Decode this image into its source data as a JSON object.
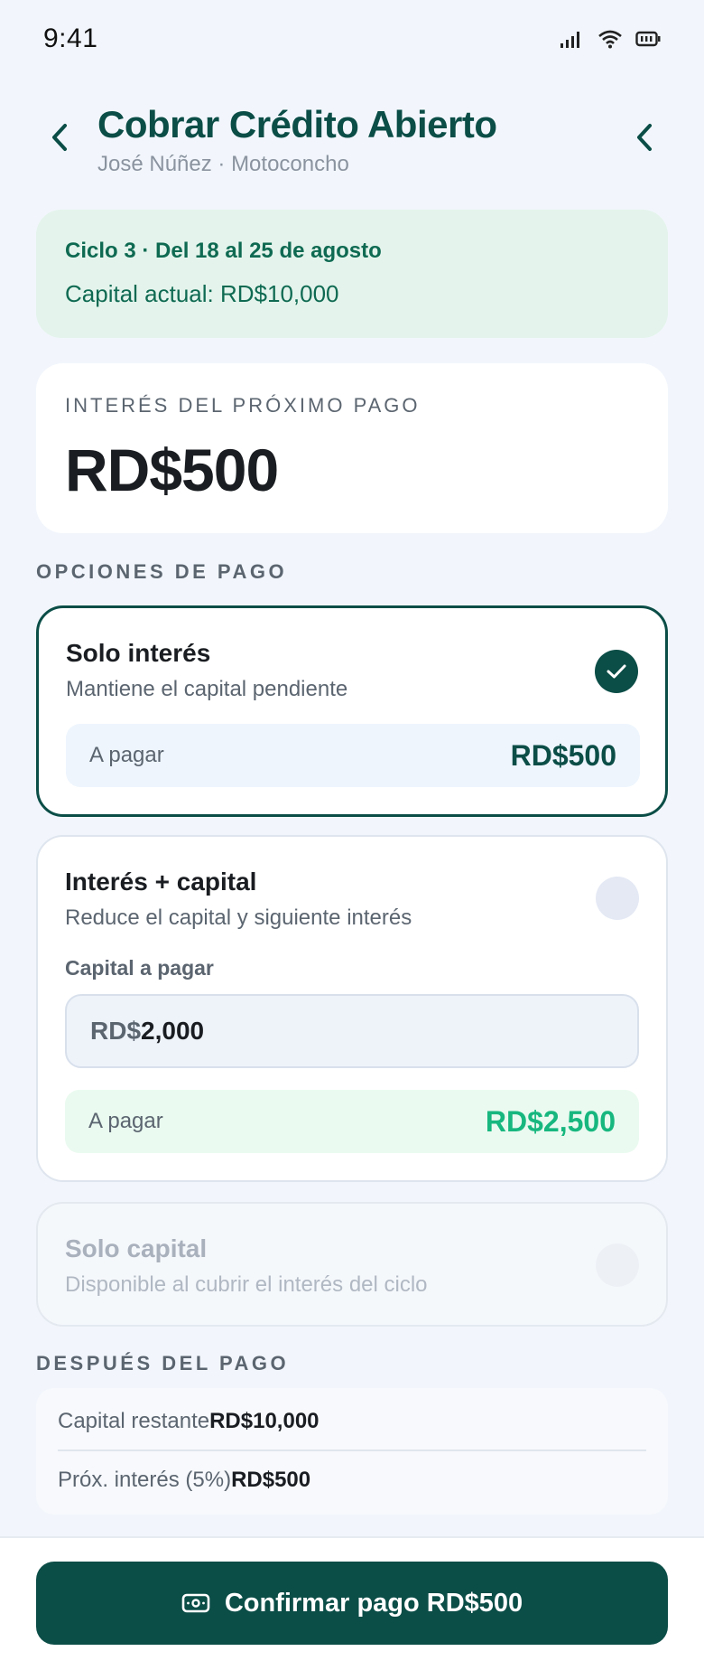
{
  "status_bar": {
    "time": "9:41"
  },
  "header": {
    "title": "Cobrar Crédito Abierto",
    "subtitle": "José Núñez · Motoconcho"
  },
  "cycle": {
    "title": "Ciclo 3 · Del 18 al 25 de agosto",
    "capital": "Capital actual: RD$10,000"
  },
  "next_interest": {
    "label": "INTERÉS DEL PRÓXIMO PAGO",
    "amount": "RD$500"
  },
  "payment_options": {
    "section_title": "OPCIONES DE PAGO",
    "options": [
      {
        "title": "Solo interés",
        "description": "Mantiene el capital pendiente",
        "pay_label": "A pagar",
        "pay_value": "RD$500",
        "selected": true
      },
      {
        "title": "Interés + capital",
        "description": "Reduce el capital y siguiente interés",
        "capital_label": "Capital a pagar",
        "capital_prefix": "RD$",
        "capital_value": "2,000",
        "pay_label": "A pagar",
        "pay_value": "RD$2,500",
        "selected": false
      },
      {
        "title": "Solo capital",
        "description": "Disponible al cubrir el interés del ciclo",
        "selected": false,
        "disabled": true
      }
    ]
  },
  "after_payment": {
    "section_title": "DESPUÉS DEL PAGO",
    "rows": [
      {
        "label": "Capital restante",
        "value": "RD$10,000"
      },
      {
        "label": "Próx. interés (5%)",
        "value": "RD$500"
      }
    ]
  },
  "confirm_button": {
    "label": "Confirmar pago RD$500",
    "icon": "cash-icon"
  },
  "colors": {
    "brand": "#0b4d47",
    "accent_green": "#17b77f",
    "cycle_bg": "#e4f4ec",
    "page_bg": "#f2f6fc"
  }
}
